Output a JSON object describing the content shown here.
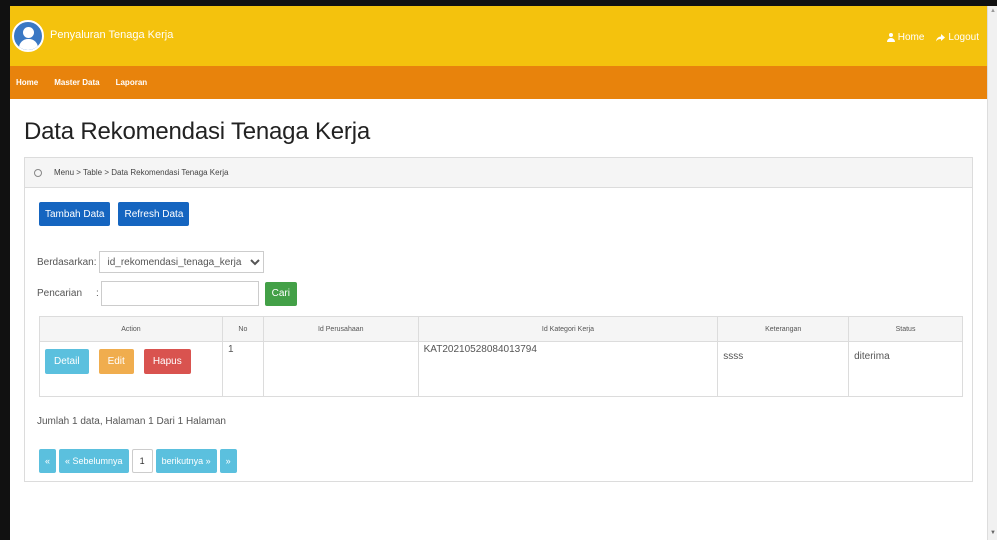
{
  "app": {
    "brand": "Penyaluran Tenaga Kerja"
  },
  "topnav": {
    "home": "Home",
    "logout": "Logout",
    "home_icon": "user-icon",
    "logout_icon": "share-icon"
  },
  "menu": [
    "Home",
    "Master Data",
    "Laporan"
  ],
  "page": {
    "title": "Data Rekomendasi Tenaga Kerja"
  },
  "breadcrumb": "Menu > Table > Data Rekomendasi Tenaga Kerja",
  "buttons": {
    "add": "Tambah Data",
    "refresh": "Refresh Data",
    "search": "Cari"
  },
  "filter": {
    "label": "Berdasarkan",
    "selected": "id_rekomendasi_tenaga_kerja"
  },
  "search": {
    "label": "Pencarian",
    "value": ""
  },
  "table": {
    "headers": [
      "Action",
      "No",
      "Id Perusahaan",
      "Id Kategori Kerja",
      "Keterangan",
      "Status"
    ],
    "rows": [
      {
        "no": "1",
        "id_perusahaan": "",
        "id_kategori": "KAT20210528084013794",
        "keterangan": "ssss",
        "status": "diterima",
        "actions": {
          "detail": "Detail",
          "edit": "Edit",
          "delete": "Hapus"
        }
      }
    ]
  },
  "summary": "Jumlah 1 data, Halaman 1 Dari 1 Halaman",
  "pager": {
    "first": "«",
    "prev": "« Sebelumnya",
    "current": "1",
    "next": "berikutnya »",
    "last": "»"
  },
  "colors": {
    "topbar": "#f4c20d",
    "menubar": "#e8830c",
    "primary": "#1565c0",
    "success": "#43a047",
    "info": "#5bc0de",
    "warning": "#f0ad4e",
    "danger": "#d9534f"
  }
}
